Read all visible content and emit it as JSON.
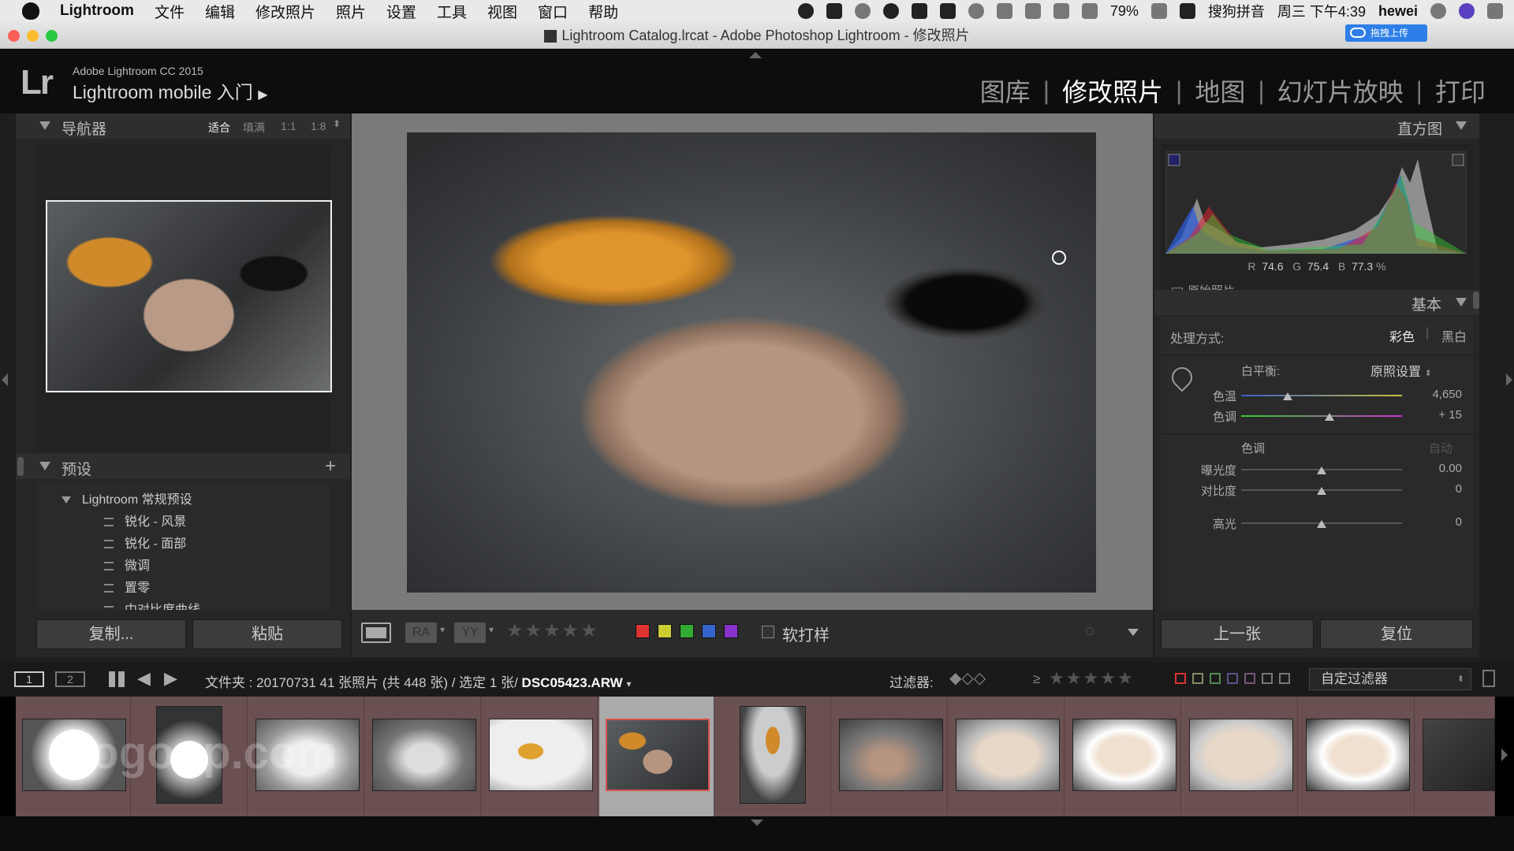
{
  "menubar": {
    "items": [
      "Lightroom",
      "文件",
      "编辑",
      "修改照片",
      "照片",
      "设置",
      "工具",
      "视图",
      "窗口",
      "帮助"
    ],
    "battery": "79%",
    "ime": "搜狗拼音",
    "clock": "周三 下午4:39",
    "user": "hewei"
  },
  "window": {
    "title": "Lightroom Catalog.lrcat - Adobe Photoshop Lightroom - 修改照片",
    "upload_label": "拖拽上传"
  },
  "identity": {
    "logo": "Lr",
    "subtitle": "Adobe Lightroom CC 2015",
    "title": "Lightroom mobile 入门"
  },
  "modules": [
    "图库",
    "修改照片",
    "地图",
    "幻灯片放映",
    "打印"
  ],
  "active_module": "修改照片",
  "navigator": {
    "title": "导航器",
    "zoom_options": [
      "适合",
      "填满",
      "1:1",
      "1:8"
    ]
  },
  "presets": {
    "title": "预设",
    "add": "+",
    "group": "Lightroom 常规预设",
    "items": [
      "锐化 - 风景",
      "锐化 - 面部",
      "微调",
      "置零",
      "中对比度曲线"
    ]
  },
  "left_buttons": {
    "copy": "复制...",
    "paste": "粘贴"
  },
  "histogram": {
    "title": "直方图",
    "r_label": "R",
    "r": "74.6",
    "g_label": "G",
    "g": "75.4",
    "b_label": "B",
    "b": "77.3",
    "unit": "%",
    "original_label": "原始照片"
  },
  "basic": {
    "title": "基本",
    "treatment_label": "处理方式:",
    "color": "彩色",
    "bw": "黑白",
    "wb_label": "白平衡:",
    "wb_value": "原照设置",
    "temp_label": "色温",
    "temp_value": "4,650",
    "temp_pos": 0.29,
    "tint_label": "色调",
    "tint_value": "+ 15",
    "tint_pos": 0.55,
    "tone_label": "色调",
    "auto_label": "自动",
    "exposure_label": "曝光度",
    "exposure_value": "0.00",
    "exposure_pos": 0.5,
    "contrast_label": "对比度",
    "contrast_value": "0",
    "contrast_pos": 0.5,
    "highlights_label": "高光",
    "highlights_value": "0",
    "highlights_pos": 0.5
  },
  "right_buttons": {
    "prev": "上一张",
    "reset": "复位"
  },
  "toolbar": {
    "soft_proof": "软打样",
    "color_labels": [
      "#d33",
      "#cc3",
      "#3a3",
      "#36c",
      "#83c"
    ]
  },
  "filterbar": {
    "pages": [
      "1",
      "2"
    ],
    "path_text": "文件夹 : 20170731    41 张照片 (共 448 张) / 选定 1 张/",
    "filename": "DSC05423.ARW",
    "filter_label": "过滤器:",
    "gte": "≥",
    "custom_filter": "自定过滤器"
  },
  "filmstrip": {
    "watermark": "gogoup.com",
    "count": 13,
    "selected_index": 5
  },
  "colors": {
    "accent_red": "#d9534f"
  }
}
